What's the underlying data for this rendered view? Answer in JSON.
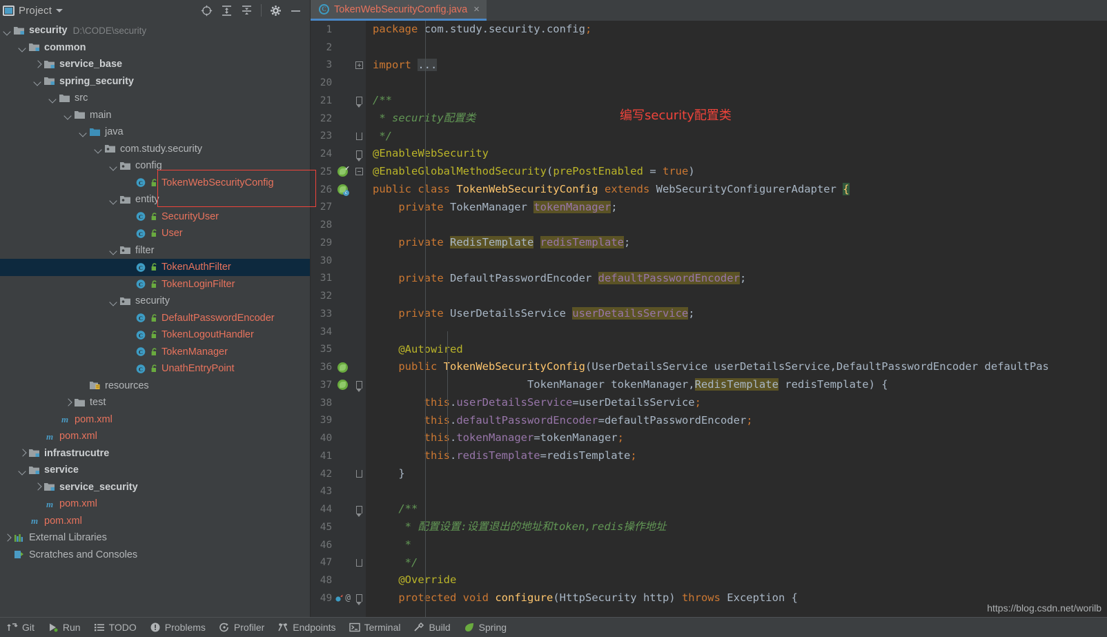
{
  "panel": {
    "title": "Project",
    "icons": [
      "project-badge-icon",
      "chevron-down-icon",
      "locate-icon",
      "expand-all-icon",
      "collapse-all-icon",
      "gear-icon",
      "minimize-icon"
    ]
  },
  "tree": {
    "items": [
      {
        "indent": 0,
        "arrow": "down",
        "icon": "module-folder-icon",
        "label": "security",
        "style": "bold",
        "hint": "D:\\CODE\\security"
      },
      {
        "indent": 1,
        "arrow": "down",
        "icon": "module-folder-icon",
        "label": "common",
        "style": "bold",
        "hint": ""
      },
      {
        "indent": 2,
        "arrow": "right",
        "icon": "module-folder-icon",
        "label": "service_base",
        "style": "bold",
        "hint": ""
      },
      {
        "indent": 2,
        "arrow": "down",
        "icon": "module-folder-icon",
        "label": "spring_security",
        "style": "bold",
        "hint": ""
      },
      {
        "indent": 3,
        "arrow": "down",
        "icon": "folder-icon",
        "label": "src",
        "style": "plain",
        "hint": ""
      },
      {
        "indent": 4,
        "arrow": "down",
        "icon": "folder-icon",
        "label": "main",
        "style": "plain",
        "hint": ""
      },
      {
        "indent": 5,
        "arrow": "down",
        "icon": "source-folder-icon",
        "label": "java",
        "style": "plain",
        "hint": ""
      },
      {
        "indent": 6,
        "arrow": "down",
        "icon": "package-icon",
        "label": "com.study.security",
        "style": "plain",
        "hint": ""
      },
      {
        "indent": 7,
        "arrow": "down",
        "icon": "package-icon",
        "label": "config",
        "style": "plain",
        "hint": ""
      },
      {
        "indent": 8,
        "arrow": "none",
        "icon": "java-class-icon",
        "label": "TokenWebSecurityConfig",
        "style": "cls",
        "hint": "",
        "lock": true
      },
      {
        "indent": 7,
        "arrow": "down",
        "icon": "package-icon",
        "label": "entity",
        "style": "plain",
        "hint": ""
      },
      {
        "indent": 8,
        "arrow": "none",
        "icon": "java-class-icon",
        "label": "SecurityUser",
        "style": "cls",
        "hint": "",
        "lock": true
      },
      {
        "indent": 8,
        "arrow": "none",
        "icon": "java-class-icon",
        "label": "User",
        "style": "cls",
        "hint": "",
        "lock": true
      },
      {
        "indent": 7,
        "arrow": "down",
        "icon": "package-icon",
        "label": "filter",
        "style": "plain",
        "hint": ""
      },
      {
        "indent": 8,
        "arrow": "none",
        "icon": "java-class-icon",
        "label": "TokenAuthFilter",
        "style": "cls",
        "hint": "",
        "lock": true,
        "selected": true
      },
      {
        "indent": 8,
        "arrow": "none",
        "icon": "java-class-icon",
        "label": "TokenLoginFilter",
        "style": "cls",
        "hint": "",
        "lock": true
      },
      {
        "indent": 7,
        "arrow": "down",
        "icon": "package-icon",
        "label": "security",
        "style": "plain",
        "hint": ""
      },
      {
        "indent": 8,
        "arrow": "none",
        "icon": "java-class-icon",
        "label": "DefaultPasswordEncoder",
        "style": "cls",
        "hint": "",
        "lock": true
      },
      {
        "indent": 8,
        "arrow": "none",
        "icon": "java-class-icon",
        "label": "TokenLogoutHandler",
        "style": "cls",
        "hint": "",
        "lock": true
      },
      {
        "indent": 8,
        "arrow": "none",
        "icon": "java-class-icon",
        "label": "TokenManager",
        "style": "cls",
        "hint": "",
        "lock": true
      },
      {
        "indent": 8,
        "arrow": "none",
        "icon": "java-class-icon",
        "label": "UnathEntryPoint",
        "style": "cls",
        "hint": "",
        "lock": true
      },
      {
        "indent": 5,
        "arrow": "none",
        "icon": "resources-folder-icon",
        "label": "resources",
        "style": "plain",
        "hint": ""
      },
      {
        "indent": 4,
        "arrow": "right",
        "icon": "folder-icon",
        "label": "test",
        "style": "plain",
        "hint": ""
      },
      {
        "indent": 3,
        "arrow": "none",
        "icon": "maven-icon",
        "label": "pom.xml",
        "style": "pom",
        "hint": ""
      },
      {
        "indent": 2,
        "arrow": "none",
        "icon": "maven-icon",
        "label": "pom.xml",
        "style": "pom",
        "hint": ""
      },
      {
        "indent": 1,
        "arrow": "right",
        "icon": "module-folder-icon",
        "label": "infrastrucutre",
        "style": "bold",
        "hint": ""
      },
      {
        "indent": 1,
        "arrow": "down",
        "icon": "module-folder-icon",
        "label": "service",
        "style": "bold",
        "hint": ""
      },
      {
        "indent": 2,
        "arrow": "right",
        "icon": "module-folder-icon",
        "label": "service_security",
        "style": "bold",
        "hint": ""
      },
      {
        "indent": 2,
        "arrow": "none",
        "icon": "maven-icon",
        "label": "pom.xml",
        "style": "pom",
        "hint": ""
      },
      {
        "indent": 1,
        "arrow": "none",
        "icon": "maven-icon",
        "label": "pom.xml",
        "style": "pom",
        "hint": ""
      },
      {
        "indent": 0,
        "arrow": "right",
        "icon": "external-libraries-icon",
        "label": "External Libraries",
        "style": "plain",
        "hint": ""
      },
      {
        "indent": 0,
        "arrow": "none",
        "icon": "scratches-icon",
        "label": "Scratches and Consoles",
        "style": "plain",
        "hint": ""
      }
    ]
  },
  "editor": {
    "tab": {
      "label": "TokenWebSecurityConfig.java",
      "icon_letter": "C",
      "close_glyph": "×"
    },
    "annotation": "编写security配置类",
    "watermark": "https://blog.csdn.net/worilb",
    "lines": [
      {
        "n": "1",
        "fold": "none",
        "mark": "none"
      },
      {
        "n": "2",
        "fold": "none",
        "mark": "none"
      },
      {
        "n": "3",
        "fold": "plus",
        "mark": "none"
      },
      {
        "n": "20",
        "fold": "none",
        "mark": "none"
      },
      {
        "n": "21",
        "fold": "start",
        "mark": "none"
      },
      {
        "n": "22",
        "fold": "none",
        "mark": "none"
      },
      {
        "n": "23",
        "fold": "end",
        "mark": "none"
      },
      {
        "n": "24",
        "fold": "start",
        "mark": "none"
      },
      {
        "n": "25",
        "fold": "minus",
        "mark": "bean-check"
      },
      {
        "n": "26",
        "fold": "none",
        "mark": "bean-badge"
      },
      {
        "n": "27",
        "fold": "none",
        "mark": "none"
      },
      {
        "n": "28",
        "fold": "none",
        "mark": "none"
      },
      {
        "n": "29",
        "fold": "none",
        "mark": "none"
      },
      {
        "n": "30",
        "fold": "none",
        "mark": "none"
      },
      {
        "n": "31",
        "fold": "none",
        "mark": "none"
      },
      {
        "n": "32",
        "fold": "none",
        "mark": "none"
      },
      {
        "n": "33",
        "fold": "none",
        "mark": "none"
      },
      {
        "n": "34",
        "fold": "none",
        "mark": "none"
      },
      {
        "n": "35",
        "fold": "none",
        "mark": "none"
      },
      {
        "n": "36",
        "fold": "none",
        "mark": "bean-arrow"
      },
      {
        "n": "37",
        "fold": "start",
        "mark": "bean-arrow"
      },
      {
        "n": "38",
        "fold": "none",
        "mark": "none"
      },
      {
        "n": "39",
        "fold": "none",
        "mark": "none"
      },
      {
        "n": "40",
        "fold": "none",
        "mark": "none"
      },
      {
        "n": "41",
        "fold": "none",
        "mark": "none"
      },
      {
        "n": "42",
        "fold": "end",
        "mark": "none"
      },
      {
        "n": "43",
        "fold": "none",
        "mark": "none"
      },
      {
        "n": "44",
        "fold": "start",
        "mark": "none"
      },
      {
        "n": "45",
        "fold": "none",
        "mark": "none"
      },
      {
        "n": "46",
        "fold": "none",
        "mark": "none"
      },
      {
        "n": "47",
        "fold": "end",
        "mark": "none"
      },
      {
        "n": "48",
        "fold": "none",
        "mark": "none"
      },
      {
        "n": "49",
        "fold": "start",
        "mark": "override-at"
      }
    ],
    "code": {
      "l1": "package com.study.security.config;",
      "l3": "import ...",
      "l21": "/**",
      "l22": " * security配置类",
      "l23": " */",
      "l24": "@EnableWebSecurity",
      "l25": "@EnableGlobalMethodSecurity(prePostEnabled = true)",
      "l26": "public class TokenWebSecurityConfig extends WebSecurityConfigurerAdapter {",
      "l27": "    private TokenManager tokenManager;",
      "l29": "    private RedisTemplate redisTemplate;",
      "l31": "    private DefaultPasswordEncoder defaultPasswordEncoder;",
      "l33": "    private UserDetailsService userDetailsService;",
      "l35": "    @Autowired",
      "l36": "    public TokenWebSecurityConfig(UserDetailsService userDetailsService,DefaultPasswordEncoder defaultPas",
      "l37": "                        TokenManager tokenManager,RedisTemplate redisTemplate) {",
      "l38": "        this.userDetailsService=userDetailsService;",
      "l39": "        this.defaultPasswordEncoder=defaultPasswordEncoder;",
      "l40": "        this.tokenManager=tokenManager;",
      "l41": "        this.redisTemplate=redisTemplate;",
      "l42": "    }",
      "l44": "    /**",
      "l45": "     * 配置设置:设置退出的地址和token,redis操作地址",
      "l46": "     *",
      "l47": "     */",
      "l48": "    @Override",
      "l49": "    protected void configure(HttpSecurity http) throws Exception {"
    }
  },
  "statusbar": {
    "items": [
      {
        "label": "Git",
        "icon": "git-branch-icon"
      },
      {
        "label": "Run",
        "icon": "run-icon"
      },
      {
        "label": "TODO",
        "icon": "todo-list-icon"
      },
      {
        "label": "Problems",
        "icon": "problems-icon"
      },
      {
        "label": "Profiler",
        "icon": "profiler-icon"
      },
      {
        "label": "Endpoints",
        "icon": "endpoints-icon"
      },
      {
        "label": "Terminal",
        "icon": "terminal-icon"
      },
      {
        "label": "Build",
        "icon": "build-hammer-icon"
      },
      {
        "label": "Spring",
        "icon": "spring-leaf-icon"
      }
    ]
  },
  "colors": {
    "panel_bg": "#3c3f41",
    "editor_bg": "#2b2b2b",
    "gutter_bg": "#313335",
    "selection": "#0d293e",
    "accent": "#4a88c7",
    "class_text": "#e8735d",
    "annotation_red": "#f0443b",
    "comment_green": "#629755",
    "keyword_orange": "#cc7832",
    "field_purple": "#9876aa",
    "anno_yellow": "#bbb529",
    "ident_highlight": "#5b5325"
  }
}
